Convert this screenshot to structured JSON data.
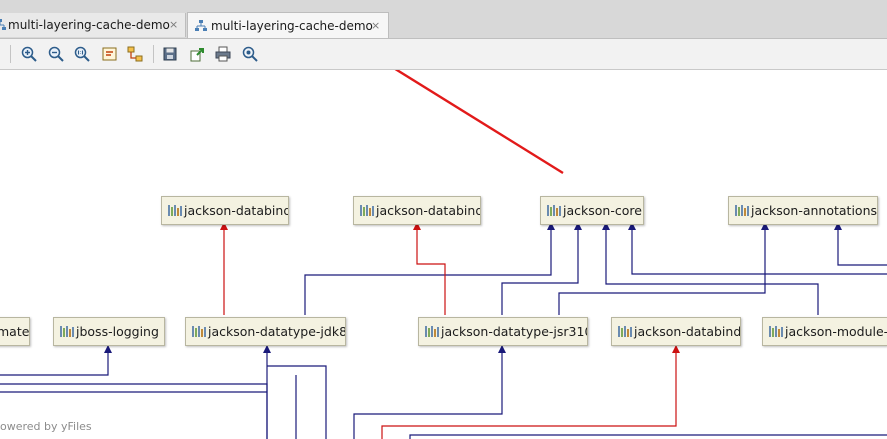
{
  "tabs": [
    {
      "label": "multi-layering-cache-demo",
      "close": "×",
      "active": false
    },
    {
      "label": "multi-layering-cache-demo",
      "close": "×",
      "active": true
    }
  ],
  "toolbar": {
    "buttons": [
      "zoom-in-icon",
      "zoom-out-icon",
      "actual-size-icon",
      "fit-content-icon",
      "layout-icon",
      "save-icon",
      "export-icon",
      "print-icon",
      "settings-icon"
    ]
  },
  "nodes": {
    "top": [
      {
        "label": "jackson-databind"
      },
      {
        "label": "jackson-databind"
      },
      {
        "label": "jackson-core"
      },
      {
        "label": "jackson-annotations"
      }
    ],
    "middle": [
      {
        "label": "mate"
      },
      {
        "label": "jboss-logging"
      },
      {
        "label": "jackson-datatype-jdk8"
      },
      {
        "label": "jackson-datatype-jsr310"
      },
      {
        "label": "jackson-databind"
      },
      {
        "label": "jackson-module-p"
      }
    ]
  },
  "watermark": "owered by yFiles",
  "colors": {
    "edge_blue": "#1a1a7a",
    "edge_red": "#cc1111",
    "arrow_red": "#e21a1a",
    "node_fill": "#f4f2e1"
  }
}
